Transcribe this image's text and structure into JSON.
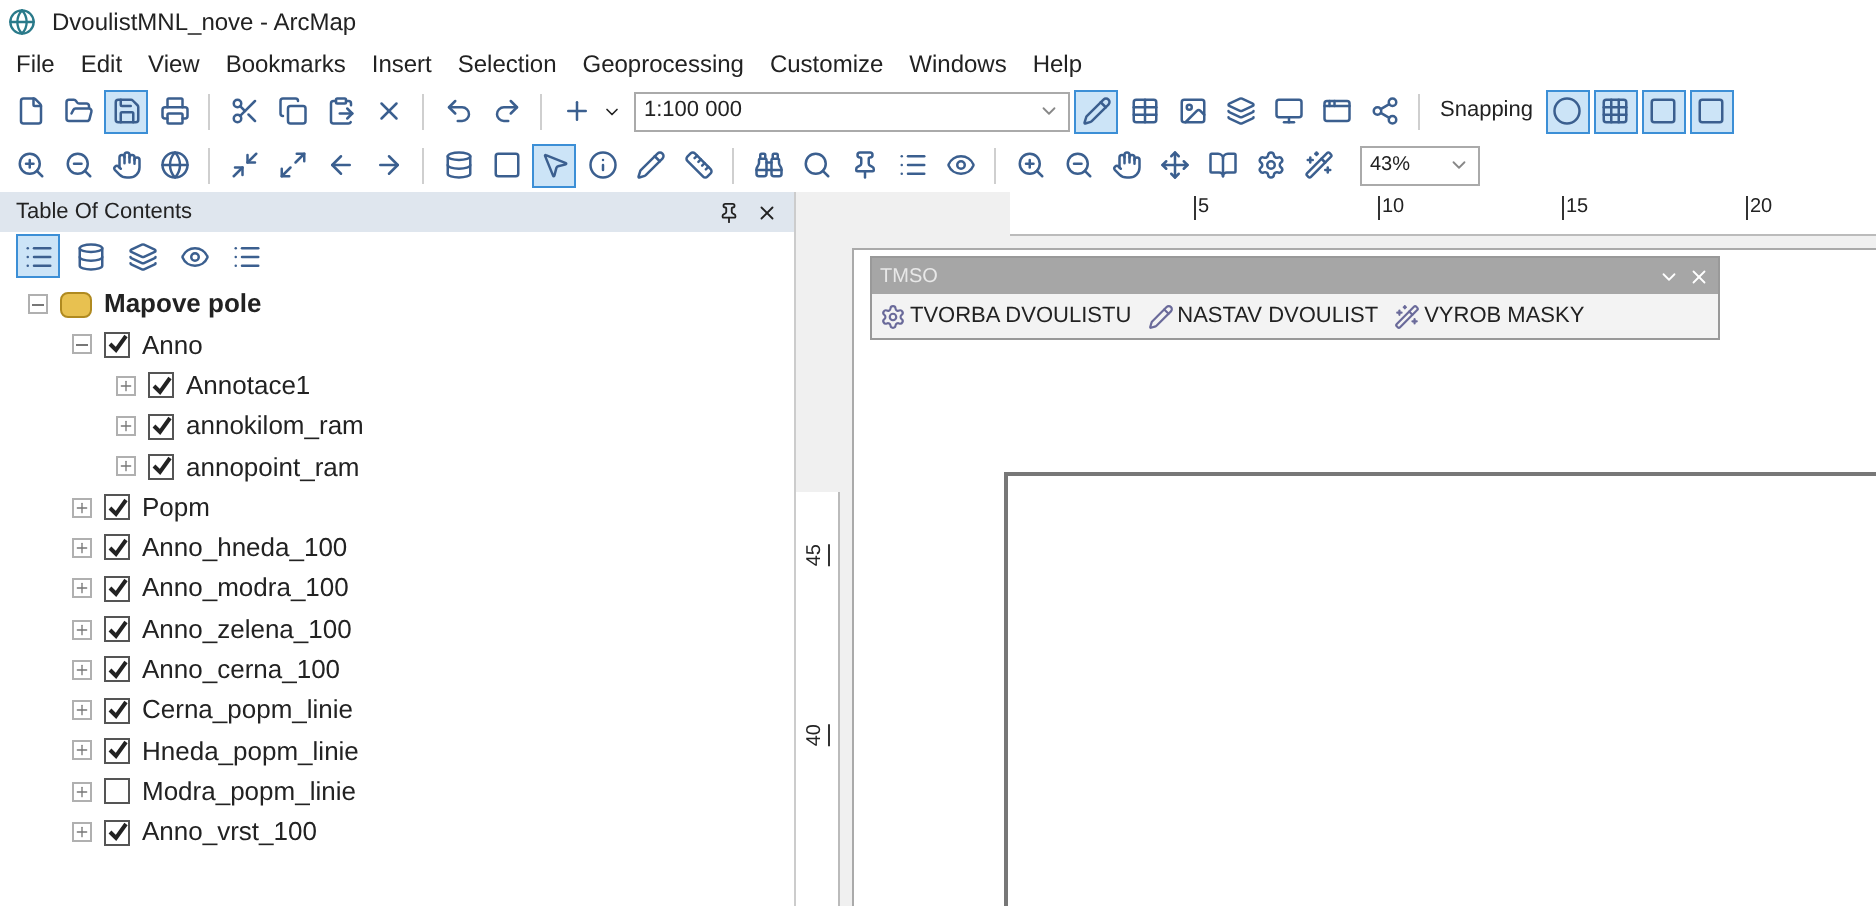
{
  "window": {
    "title": "DvoulistMNL_nove - ArcMap"
  },
  "menu": [
    "File",
    "Edit",
    "View",
    "Bookmarks",
    "Insert",
    "Selection",
    "Geoprocessing",
    "Customize",
    "Windows",
    "Help"
  ],
  "toolbar": {
    "scale": "1:100 000",
    "snapping_label": "Snapping",
    "zoom": "43%"
  },
  "toc": {
    "title": "Table Of Contents",
    "tree": [
      {
        "label": "Mapove pole",
        "kind": "frame",
        "expanded": true,
        "children": [
          {
            "label": "Anno",
            "kind": "layer",
            "checked": true,
            "expanded": true,
            "children": [
              {
                "label": "Annotace1",
                "kind": "layer",
                "checked": true,
                "expanded": false
              },
              {
                "label": "annokilom_ram",
                "kind": "layer",
                "checked": true,
                "expanded": false
              },
              {
                "label": "annopoint_ram",
                "kind": "layer",
                "checked": true,
                "expanded": false
              }
            ]
          },
          {
            "label": "Popm",
            "kind": "layer",
            "checked": true,
            "expanded": false
          },
          {
            "label": "Anno_hneda_100",
            "kind": "layer",
            "checked": true,
            "expanded": false
          },
          {
            "label": "Anno_modra_100",
            "kind": "layer",
            "checked": true,
            "expanded": false
          },
          {
            "label": "Anno_zelena_100",
            "kind": "layer",
            "checked": true,
            "expanded": false
          },
          {
            "label": "Anno_cerna_100",
            "kind": "layer",
            "checked": true,
            "expanded": false
          },
          {
            "label": "Cerna_popm_linie",
            "kind": "layer",
            "checked": true,
            "expanded": false
          },
          {
            "label": "Hneda_popm_linie",
            "kind": "layer",
            "checked": true,
            "expanded": false
          },
          {
            "label": "Modra_popm_linie",
            "kind": "layer",
            "checked": false,
            "expanded": false
          },
          {
            "label": "Anno_vrst_100",
            "kind": "layer",
            "checked": true,
            "expanded": false
          }
        ]
      }
    ]
  },
  "ruler": {
    "horizontal": [
      "5",
      "10",
      "15",
      "20"
    ],
    "vertical": [
      "45",
      "40"
    ]
  },
  "floating_toolbar": {
    "title": "TMSO",
    "buttons": [
      "TVORBA DVOULISTU",
      "NASTAV DVOULIST",
      "VYROB MASKY"
    ]
  }
}
